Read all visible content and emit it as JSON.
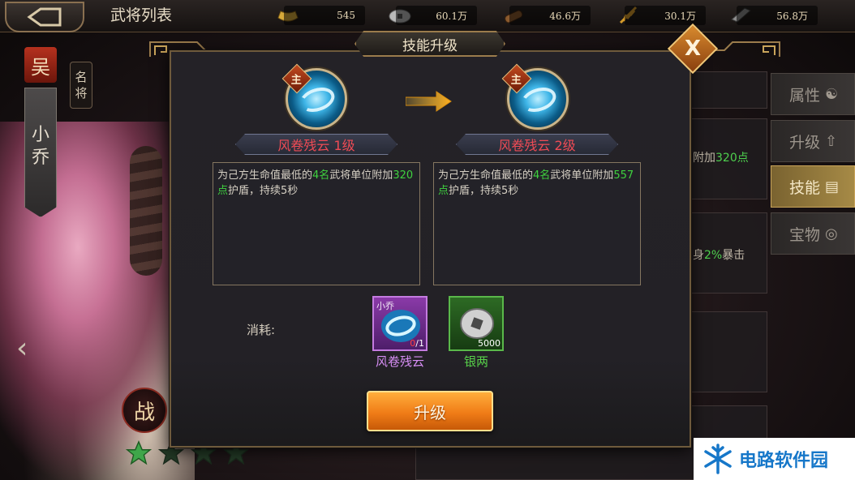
{
  "topbar": {
    "title": "武将列表",
    "resources": [
      {
        "icon": "gold-ingot-icon",
        "value": "545"
      },
      {
        "icon": "silver-coin-icon",
        "value": "60.1万"
      },
      {
        "icon": "wood-icon",
        "value": "46.6万"
      },
      {
        "icon": "grain-icon",
        "value": "30.1万"
      },
      {
        "icon": "iron-icon",
        "value": "56.8万"
      }
    ]
  },
  "hero": {
    "faction": "吴",
    "rank_label": [
      "名",
      "将"
    ],
    "name": [
      "小",
      "乔"
    ],
    "battle_char": "战"
  },
  "side_tabs": [
    {
      "label": "属性",
      "icon": "attribute-icon",
      "active": false
    },
    {
      "label": "升级",
      "icon": "upgrade-arrow-icon",
      "active": false
    },
    {
      "label": "技能",
      "icon": "skill-book-icon",
      "active": true
    },
    {
      "label": "宝物",
      "icon": "treasure-icon",
      "active": false
    }
  ],
  "background_snippets": {
    "line1_prefix": "附加",
    "line1_value": "320点",
    "line2_prefix": "身",
    "line2_value": "2%",
    "line2_suffix": "暴击"
  },
  "modal": {
    "title": "技能升级",
    "close_label": "X",
    "badge_label": "主",
    "current": {
      "name": "风卷残云 1级",
      "desc_1": "为己方生命值最低的",
      "desc_2": "4名",
      "desc_3": "武将单位附加",
      "desc_4": "320点",
      "desc_5": "护盾，持续5秒"
    },
    "next": {
      "name": "风卷残云 2级",
      "desc_1": "为己方生命值最低的",
      "desc_2": "4名",
      "desc_3": "武将单位附加",
      "desc_4": "557点",
      "desc_5": "护盾，持续5秒"
    },
    "cost_label": "消耗:",
    "costs": [
      {
        "name": "风卷残云",
        "owner": "小乔",
        "qty_have": "0",
        "qty_need": "/1",
        "rarity_color": "#8a3aa8"
      },
      {
        "name": "银两",
        "qty": "5000",
        "rarity_color": "#2d6a24"
      }
    ],
    "upgrade_button": "升级"
  },
  "watermark": {
    "text": "电路软件园"
  }
}
